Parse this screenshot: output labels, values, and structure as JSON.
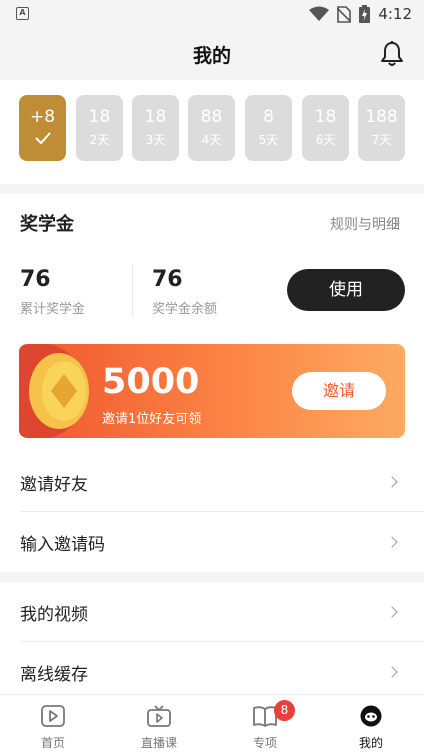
{
  "status_bar": {
    "time": "4:12",
    "notification_glyph": "A"
  },
  "header": {
    "title": "我的"
  },
  "checkin": {
    "days": [
      {
        "points": "+8",
        "label": "",
        "checked": true
      },
      {
        "points": "18",
        "label": "2天"
      },
      {
        "points": "18",
        "label": "3天"
      },
      {
        "points": "88",
        "label": "4天"
      },
      {
        "points": "8",
        "label": "5天"
      },
      {
        "points": "18",
        "label": "6天"
      },
      {
        "points": "188",
        "label": "7天"
      }
    ]
  },
  "scholarship": {
    "title": "奖学金",
    "rules_link": "规则与明细",
    "total": {
      "value": "76",
      "label": "累计奖学金"
    },
    "balance": {
      "value": "76",
      "label": "奖学金余额"
    },
    "use_button": "使用"
  },
  "invite_banner": {
    "amount": "5000",
    "description": "邀请1位好友可领",
    "button": "邀请"
  },
  "menu": [
    {
      "label": "邀请好友"
    },
    {
      "label": "输入邀请码"
    },
    {
      "label": "我的视频"
    },
    {
      "label": "离线缓存"
    }
  ],
  "bottom_nav": [
    {
      "label": "首页",
      "icon": "home-play-icon"
    },
    {
      "label": "直播课",
      "icon": "live-tv-icon"
    },
    {
      "label": "专项",
      "icon": "book-icon",
      "badge": "8"
    },
    {
      "label": "我的",
      "icon": "profile-icon",
      "active": true
    }
  ],
  "colors": {
    "gold": "#bf8d35",
    "orange_start": "#f0572d",
    "orange_end": "#fdaa62",
    "badge": "#e8413b"
  }
}
